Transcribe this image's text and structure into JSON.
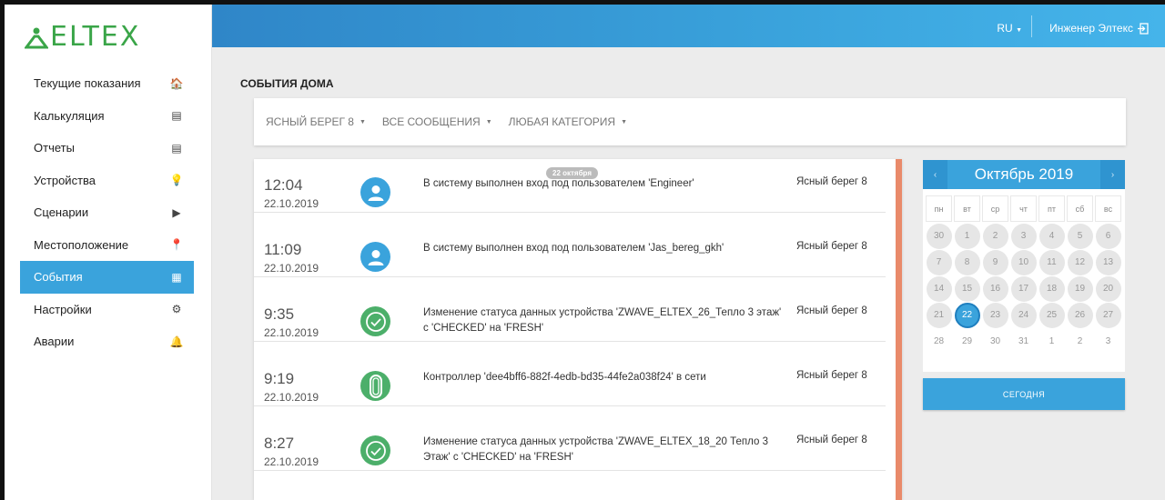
{
  "brand": {
    "logo_text": "ELTEX",
    "color": "#3aa548"
  },
  "header": {
    "lang": "RU",
    "user": "Инженер Элтекс",
    "accent": "#3aa3dc"
  },
  "sidebar": {
    "items": [
      {
        "label": "Текущие показания",
        "icon": "home-icon",
        "glyph": "🏠",
        "active": false
      },
      {
        "label": "Калькуляция",
        "icon": "calculator-icon",
        "glyph": "▤",
        "active": false
      },
      {
        "label": "Отчеты",
        "icon": "report-icon",
        "glyph": "▤",
        "active": false
      },
      {
        "label": "Устройства",
        "icon": "lightbulb-icon",
        "glyph": "💡",
        "active": false
      },
      {
        "label": "Сценарии",
        "icon": "play-icon",
        "glyph": "▶",
        "active": false
      },
      {
        "label": "Местоположение",
        "icon": "map-pin-icon",
        "glyph": "📍",
        "active": false
      },
      {
        "label": "События",
        "icon": "calendar-icon",
        "glyph": "▦",
        "active": true
      },
      {
        "label": "Настройки",
        "icon": "gear-icon",
        "glyph": "⚙",
        "active": false
      },
      {
        "label": "Аварии",
        "icon": "alarm-bell-icon",
        "glyph": "🔔",
        "active": false
      }
    ]
  },
  "main": {
    "title": "СОБЫТИЯ ДОМА",
    "filters": [
      {
        "label": "ЯСНЫЙ БЕРЕГ 8"
      },
      {
        "label": "ВСЕ СООБЩЕНИЯ"
      },
      {
        "label": "ЛЮБАЯ КАТЕГОРИЯ"
      }
    ],
    "date_pill": "22 октября",
    "events": [
      {
        "time": "12:04",
        "date": "22.10.2019",
        "icon": "user-icon",
        "color": "blue",
        "text": "В систему выполнен вход под пользователем 'Engineer'",
        "location": "Ясный берег 8"
      },
      {
        "time": "11:09",
        "date": "22.10.2019",
        "icon": "user-icon",
        "color": "blue",
        "text": "В систему выполнен вход под пользователем 'Jas_bereg_gkh'",
        "location": "Ясный берег 8"
      },
      {
        "time": "9:35",
        "date": "22.10.2019",
        "icon": "check-circle-icon",
        "color": "green",
        "text": "Изменение статуса данных устройства 'ZWAVE_ELTEX_26_Тепло 3 этаж' с 'CHECKED' на 'FRESH'",
        "location": "Ясный берег 8"
      },
      {
        "time": "9:19",
        "date": "22.10.2019",
        "icon": "controller-icon",
        "color": "green",
        "text": "Контроллер 'dee4bff6-882f-4edb-bd35-44fe2a038f24' в сети",
        "location": "Ясный берег 8"
      },
      {
        "time": "8:27",
        "date": "22.10.2019",
        "icon": "check-circle-icon",
        "color": "green",
        "text": "Изменение статуса данных устройства 'ZWAVE_ELTEX_18_20 Тепло 3 Этаж' с 'CHECKED' на 'FRESH'",
        "location": "Ясный берег 8"
      }
    ]
  },
  "calendar": {
    "title": "Октябрь 2019",
    "prev": "‹",
    "next": "›",
    "dow": [
      "пн",
      "вт",
      "ср",
      "чт",
      "пт",
      "сб",
      "вс"
    ],
    "weeks": [
      [
        "30",
        "1",
        "2",
        "3",
        "4",
        "5",
        "6"
      ],
      [
        "7",
        "8",
        "9",
        "10",
        "11",
        "12",
        "13"
      ],
      [
        "14",
        "15",
        "16",
        "17",
        "18",
        "19",
        "20"
      ],
      [
        "21",
        "22",
        "23",
        "24",
        "25",
        "26",
        "27"
      ],
      [
        "28",
        "29",
        "30",
        "31",
        "1",
        "2",
        "3"
      ]
    ],
    "selected": "22",
    "today_label": "СЕГОДНЯ"
  }
}
